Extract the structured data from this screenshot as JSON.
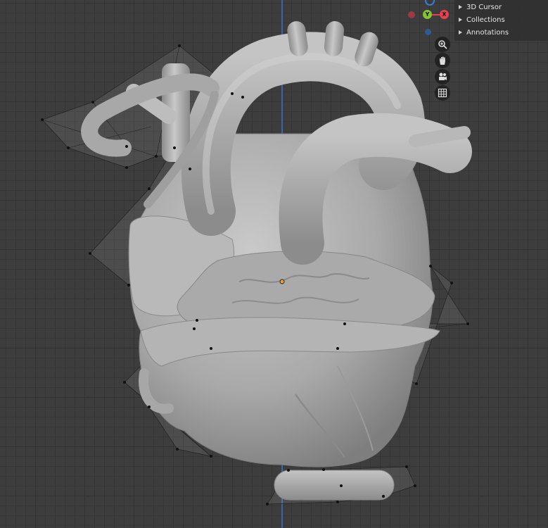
{
  "outliner": {
    "items": [
      {
        "label": "3D Cursor"
      },
      {
        "label": "Collections"
      },
      {
        "label": "Annotations"
      }
    ]
  },
  "gizmo": {
    "y_label": "Y",
    "x_label": "X",
    "colors": {
      "x": "#e8404f",
      "y": "#86c330",
      "z": "#3a7ad8",
      "neg_x": "#9b3a44",
      "neg_z": "#2f5a94"
    }
  },
  "navigation": {
    "tools": [
      {
        "icon": "zoom-icon"
      },
      {
        "icon": "hand-pan-icon"
      },
      {
        "icon": "camera-icon"
      },
      {
        "icon": "grid-icon"
      }
    ]
  },
  "scene": {
    "object": "heart-model-with-cage",
    "origin_color": "#f0a030"
  }
}
